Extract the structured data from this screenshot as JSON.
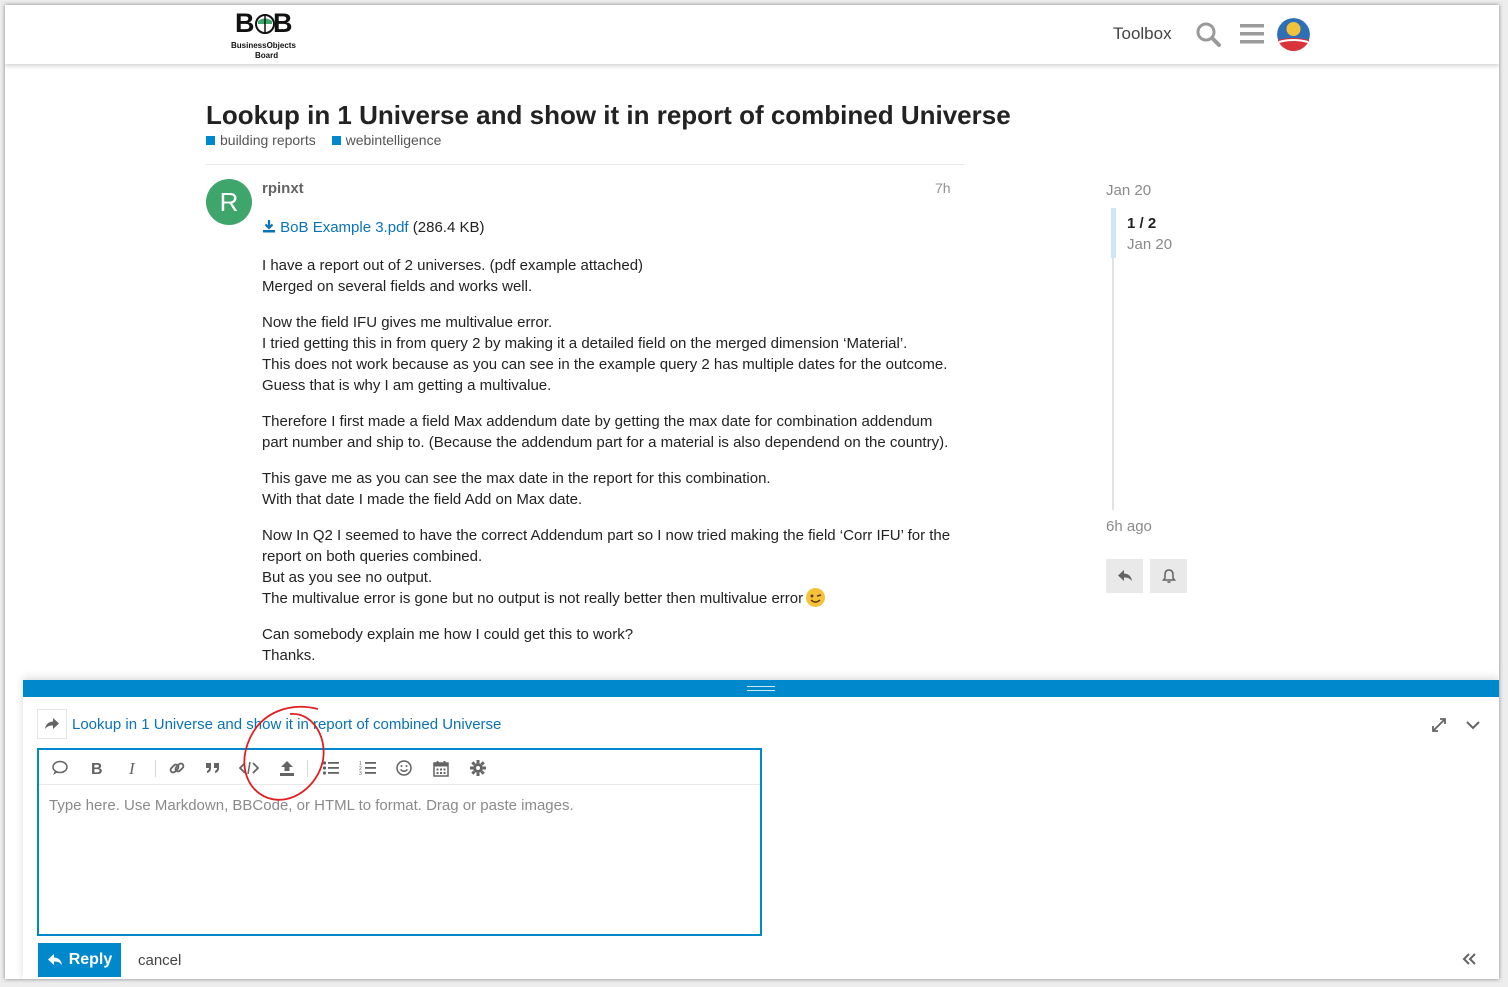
{
  "header": {
    "logo_text": "BoB",
    "logo_sub1": "BusinessObjects",
    "logo_sub2": "Board",
    "toolbox_label": "Toolbox",
    "icons": [
      "search-icon",
      "hamburger-menu-icon",
      "user-avatar"
    ]
  },
  "topic": {
    "title": "Lookup in 1 Universe and show it in report of combined Universe",
    "categories": [
      {
        "label": "building reports",
        "color": "#0088cc"
      },
      {
        "label": "webintelligence",
        "color": "#0088cc"
      }
    ]
  },
  "post": {
    "avatar_letter": "R",
    "avatar_color": "#3ea56b",
    "username": "rpinxt",
    "age": "7h",
    "attachment": {
      "name": "BoB Example 3.pdf",
      "size": "(286.4 KB)"
    },
    "paragraphs": [
      [
        "I have a report out of 2 universes. (pdf example attached)",
        "Merged on several fields and works well."
      ],
      [
        "Now the field IFU gives me multivalue error.",
        "I tried getting this in from query 2 by making it a detailed field on the merged dimension ‘Material’.",
        "This does not work because as you can see in the example query 2 has multiple dates for the outcome.",
        "Guess that is why I am getting a multivalue."
      ],
      [
        "Therefore I first made a field Max addendum date by getting the max date for combination addendum",
        "part number and ship to. (Because the addendum part for a material is also dependend on the country)."
      ],
      [
        "This gave me as you can see the max date in the report for this combination.",
        "With that date I made the field Add on Max date."
      ],
      [
        "Now In Q2 I seemed to have the correct Addendum part so I now tried making the field ‘Corr IFU’ for the",
        "report on both queries combined.",
        "But as you see no output.",
        "The multivalue error is gone but no output is not really better then multivalue error"
      ],
      [
        "Can somebody explain me how I could get this to work?",
        "Thanks."
      ]
    ]
  },
  "timeline": {
    "start_date": "Jan 20",
    "count": "1 / 2",
    "current_date": "Jan 20",
    "last_activity": "6h ago"
  },
  "composer": {
    "reply_to_title": "Lookup in 1 Universe and show it in report of combined Universe",
    "placeholder": "Type here. Use Markdown, BBCode, or HTML to format. Drag or paste images.",
    "reply_label": "Reply",
    "cancel_label": "cancel",
    "toolbar_icons": [
      "quote-icon",
      "bold-icon",
      "italic-icon",
      "link-icon",
      "blockquote-icon",
      "code-icon",
      "upload-icon",
      "bullet-list-icon",
      "numbered-list-icon",
      "emoji-icon",
      "calendar-icon",
      "gear-icon"
    ]
  },
  "colors": {
    "accent": "#0088cc",
    "link": "#0a73b8",
    "annotation": "#e02020"
  }
}
